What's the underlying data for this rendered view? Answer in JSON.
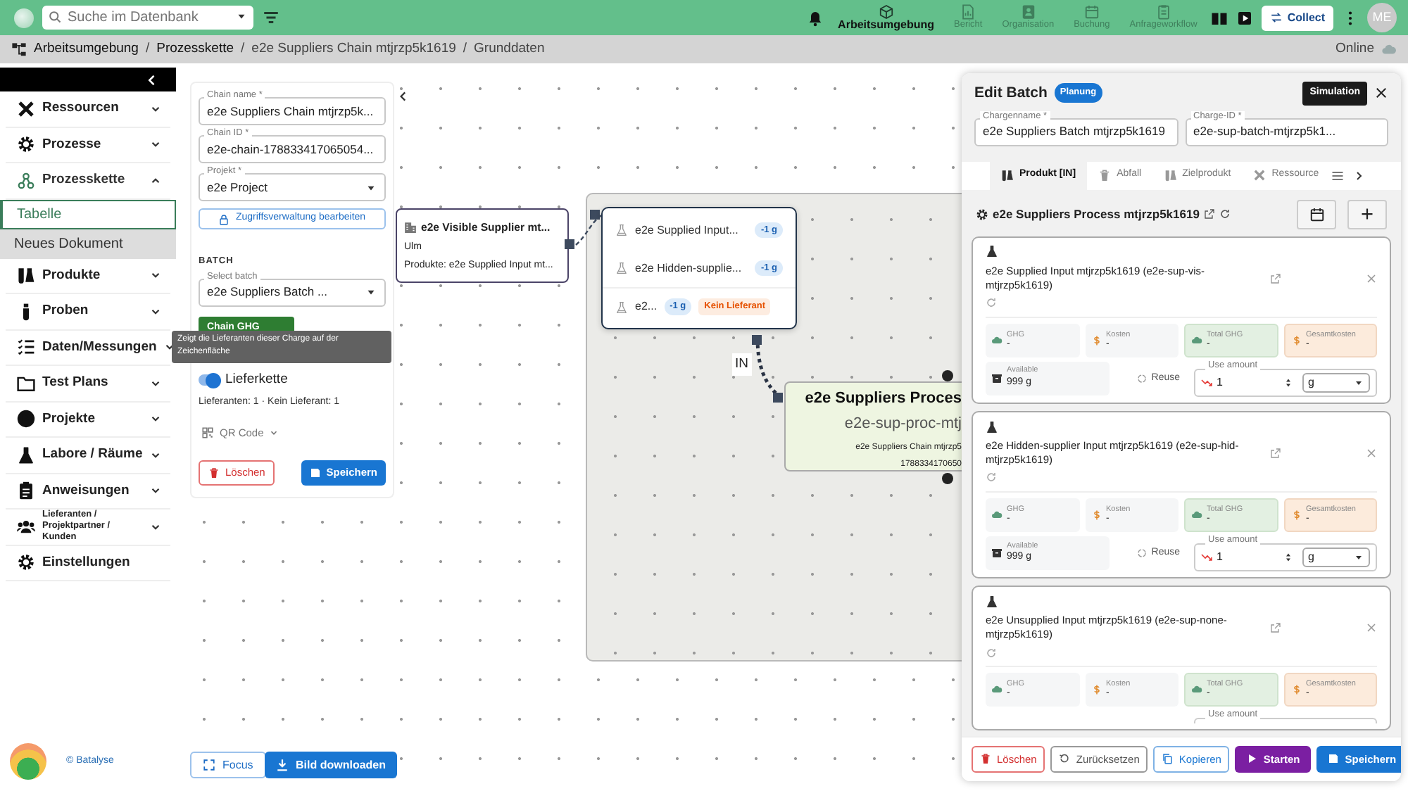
{
  "top_bar": {
    "search": {
      "placeholder": "Suche im Datenbank"
    },
    "nav": [
      {
        "label": "Arbeitsumgebung",
        "selected": true
      },
      {
        "label": "Bericht",
        "selected": false
      },
      {
        "label": "Organisation",
        "selected": false
      },
      {
        "label": "Buchung",
        "selected": false
      },
      {
        "label": "Anfrageworkflow",
        "selected": false
      }
    ],
    "collect_button": "Collect",
    "avatar": "ME"
  },
  "breadcrumb": {
    "separator": "/",
    "items": [
      "Arbeitsumgebung",
      "Prozesskette",
      "e2e Suppliers Chain mtjrzp5k1619",
      "Grunddaten"
    ],
    "status": "Online"
  },
  "sidebar": {
    "items": [
      {
        "label": "Ressourcen",
        "kind": "group",
        "expanded": false
      },
      {
        "label": "Prozesse",
        "kind": "group",
        "expanded": false
      },
      {
        "label": "Prozesskette",
        "kind": "group",
        "expanded": true,
        "children": [
          {
            "label": "Tabelle",
            "selected": true
          },
          {
            "label": "Neues Dokument",
            "selected": false
          }
        ]
      },
      {
        "label": "Produkte",
        "kind": "group",
        "expanded": false
      },
      {
        "label": "Proben",
        "kind": "group",
        "expanded": false
      },
      {
        "label": "Daten/Messungen",
        "kind": "group",
        "expanded": false
      },
      {
        "label": "Test Plans",
        "kind": "group",
        "expanded": false
      },
      {
        "label": "Projekte",
        "kind": "group",
        "expanded": false
      },
      {
        "label": "Labore / Räume",
        "kind": "group",
        "expanded": false
      },
      {
        "label": "Anweisungen",
        "kind": "group",
        "expanded": false
      },
      {
        "label": "Lieferanten / Projektpartner / Kunden",
        "kind": "group",
        "expanded": false
      },
      {
        "label": "Einstellungen",
        "kind": "link"
      }
    ],
    "footer": "© Batalyse"
  },
  "chain_form": {
    "fields": [
      {
        "label": "Chain name *",
        "value": "e2e Suppliers Chain mtjrzp5k...",
        "kind": "text"
      },
      {
        "label": "Chain ID *",
        "value": "e2e-chain-178833417065054...",
        "kind": "text"
      },
      {
        "label": "Projekt *",
        "value": "e2e Project",
        "kind": "select"
      }
    ],
    "access_button": "Zugriffsverwaltung bearbeiten",
    "batch_heading": "BATCH",
    "batch_select": {
      "label": "Select batch",
      "value": "e2e Suppliers Batch ..."
    },
    "chain_ghg_button": "Chain GHG",
    "supply_chain_toggle": {
      "label": "Lieferkette",
      "on": true
    },
    "supplier_summary": "Lieferanten: 1 · Kein Lieferant: 1",
    "qr_code": "QR Code",
    "delete_button": "Löschen",
    "save_button": "Speichern"
  },
  "tooltip": "Zeigt die Lieferanten dieser Charge auf der Zeichenfläche",
  "canvas": {
    "supplier_node": {
      "title": "e2e Visible Supplier mt...",
      "location": "Ulm",
      "products": "Produkte: e2e Supplied Input mt..."
    },
    "inputs_node": {
      "items": [
        {
          "name": "e2e Supplied Input...",
          "amount": "-1 g"
        },
        {
          "name": "e2e Hidden-supplie...",
          "amount": "-1 g"
        },
        {
          "name": "e2...",
          "amount": "-1 g",
          "badge": "Kein Lieferant"
        }
      ]
    },
    "edge_label": "IN",
    "process_node": {
      "title": "e2e Suppliers Proces",
      "id": "e2e-sup-proc-mtj",
      "chain": "e2e Suppliers Chain mtjrzp5",
      "number": "1788334170650"
    },
    "focus_button": "Focus",
    "download_button": "Bild downloaden"
  },
  "edit_batch": {
    "title": "Edit Batch",
    "status_badge": "Planung",
    "simulation_button": "Simulation",
    "fields": [
      {
        "label": "Chargenname *",
        "value": "e2e Suppliers Batch mtjrzp5k1619"
      },
      {
        "label": "Charge-ID *",
        "value": "e2e-sup-batch-mtjrzp5k1..."
      }
    ],
    "tabs": [
      {
        "label": "Produkt [IN]",
        "selected": true
      },
      {
        "label": "Abfall",
        "selected": false
      },
      {
        "label": "Zielprodukt",
        "selected": false
      },
      {
        "label": "Ressource",
        "selected": false
      }
    ],
    "process_title": "e2e Suppliers Process mtjrzp5k1619",
    "inputs": [
      {
        "name": "e2e Supplied Input mtjrzp5k1619 (e2e-sup-vis-mtjrzp5k1619)",
        "metrics": [
          {
            "label": "GHG",
            "value": "-",
            "kind": "ghg"
          },
          {
            "label": "Kosten",
            "value": "-",
            "kind": "cost"
          },
          {
            "label": "Total GHG",
            "value": "-",
            "kind": "total_ghg"
          },
          {
            "label": "Gesamtkosten",
            "value": "-",
            "kind": "total_cost"
          }
        ],
        "available_label": "Available",
        "available": "999 g",
        "reuse": "Reuse",
        "use_amount": {
          "label": "Use amount",
          "value": "1",
          "unit": "g"
        }
      },
      {
        "name": "e2e Hidden-supplier Input mtjrzp5k1619 (e2e-sup-hid-mtjrzp5k1619)",
        "metrics": [
          {
            "label": "GHG",
            "value": "-",
            "kind": "ghg"
          },
          {
            "label": "Kosten",
            "value": "-",
            "kind": "cost"
          },
          {
            "label": "Total GHG",
            "value": "-",
            "kind": "total_ghg"
          },
          {
            "label": "Gesamtkosten",
            "value": "-",
            "kind": "total_cost"
          }
        ],
        "available_label": "Available",
        "available": "999 g",
        "reuse": "Reuse",
        "use_amount": {
          "label": "Use amount",
          "value": "1",
          "unit": "g"
        }
      },
      {
        "name": "e2e Unsupplied Input mtjrzp5k1619 (e2e-sup-none-mtjrzp5k1619)",
        "metrics": [
          {
            "label": "GHG",
            "value": "-",
            "kind": "ghg"
          },
          {
            "label": "Kosten",
            "value": "-",
            "kind": "cost"
          },
          {
            "label": "Total GHG",
            "value": "-",
            "kind": "total_ghg"
          },
          {
            "label": "Gesamtkosten",
            "value": "-",
            "kind": "total_cost"
          }
        ],
        "use_amount": {
          "label": "Use amount"
        }
      }
    ],
    "footer_buttons": [
      {
        "label": "Löschen",
        "kind": "delete"
      },
      {
        "label": "Zurücksetzen",
        "kind": "reset"
      },
      {
        "label": "Kopieren",
        "kind": "copy"
      },
      {
        "label": "Starten",
        "kind": "start"
      },
      {
        "label": "Speichern",
        "kind": "save"
      }
    ]
  }
}
